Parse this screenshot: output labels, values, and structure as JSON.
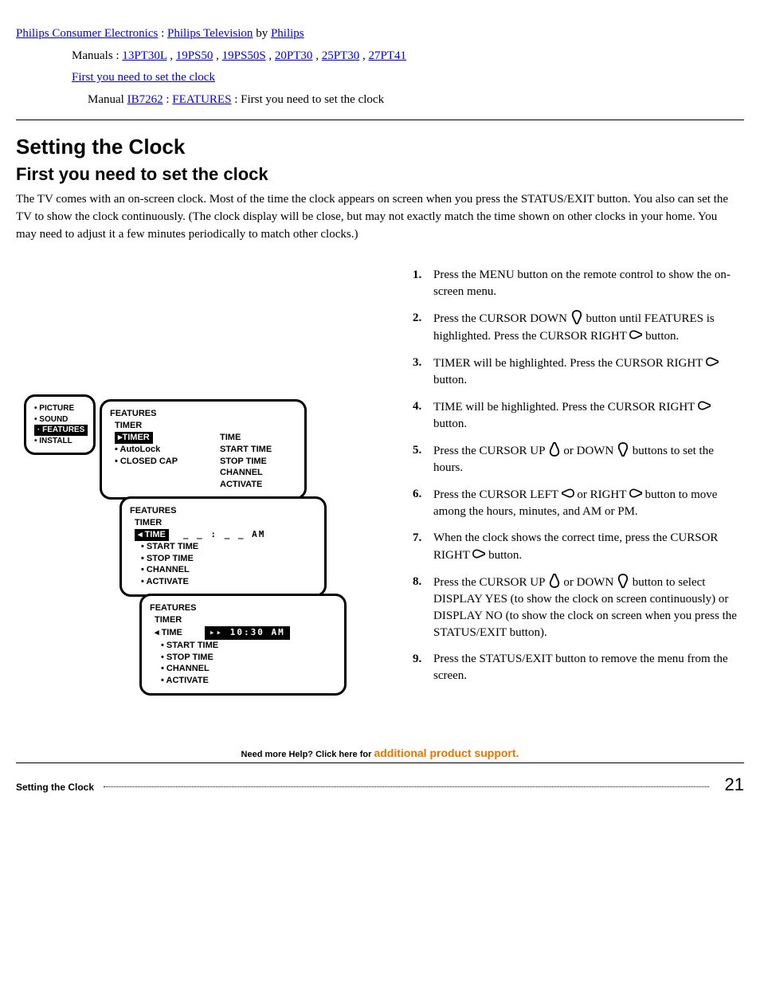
{
  "breadcrumbs": {
    "home": "Philips Consumer Electronics",
    "div": "Philips Television",
    "by": "by ",
    "div2": "Philips",
    "line2_lead": "Manuals : ",
    "m1": "13PT30L",
    "m2": "19PS50",
    "m3": "19PS50S",
    "m4": "20PT30",
    "m5": "25PT30",
    "m6": "27PT41",
    "line3": "First you need to set the clock",
    "line4_pre": "Manual ",
    "mnum": "IB7262",
    "features": "FEATURES",
    "tail": " : First you need to set the clock",
    "opdiv": "  :  "
  },
  "heading1": "Setting the Clock",
  "heading2": "First you need to set the clock",
  "intro": "The TV comes with an on-screen clock. Most of the time the clock appears on screen when you press the STATUS/EXIT button. You also can set the TV to show the clock continuously. (The clock display will be close, but may not exactly match the time shown on other clocks in your home. You may need to adjust it a few minutes periodically to match other clocks.)",
  "steps": {
    "s1": "Press the MENU button on the remote control to show the on-screen menu.",
    "s2a": "Press the CURSOR DOWN ",
    "s2b": " button until FEATURES is highlighted. Press the CURSOR RIGHT ",
    "s2c": " button.",
    "s3a": "TIMER will be highlighted. Press the CURSOR RIGHT ",
    "s3b": " button.",
    "s4a": "TIME will be highlighted. Press the CURSOR RIGHT ",
    "s4b": " button.",
    "s5a": "Press the CURSOR UP ",
    "s5b": " or DOWN ",
    "s5c": " buttons to set the hours.",
    "s6a": "Press the CURSOR LEFT ",
    "s6b": " or RIGHT ",
    "s6c": " button to move among the hours, minutes, and AM or PM.",
    "s7a": "When the clock shows the correct time, press the CURSOR RIGHT ",
    "s7b": " button.",
    "s8a": "Press the CURSOR UP ",
    "s8b": " or DOWN ",
    "s8c": " button to select DISPLAY YES (to show the clock on screen continuously) or DISPLAY NO (to show the clock on screen when you press the STATUS/EXIT button).",
    "s9": "Press the STATUS/EXIT button to remove the menu from the screen."
  },
  "osd": {
    "panel1": {
      "i1": "PICTURE",
      "i2": "SOUND",
      "i3": "FEATURES",
      "i4": "INSTALL"
    },
    "panel2": {
      "title": "FEATURES",
      "sub": "TIMER",
      "tl1": "TIMER",
      "tl2": "AutoLock",
      "tl3": "CLOSED CAP",
      "r1": "TIME",
      "r2": "START TIME",
      "r3": "STOP TIME",
      "r4": "CHANNEL",
      "r5": "ACTIVATE"
    },
    "panel3": {
      "title": "FEATURES",
      "sub": "TIMER",
      "v1": "TIME",
      "am": "_ _ : _ _   AM",
      "l1": "START TIME",
      "l2": "STOP TIME",
      "l3": "CHANNEL",
      "l4": "ACTIVATE"
    },
    "panel4": {
      "title": "FEATURES",
      "sub": "TIMER",
      "v1": "TIME",
      "t": "▸▸ 10:30 AM",
      "l1": "START TIME",
      "l2": "STOP TIME",
      "l3": "CHANNEL",
      "l4": "ACTIVATE"
    }
  },
  "footer": {
    "help": "Need more Help? Click here for ",
    "prod": "additional product support.",
    "title": "Setting the Clock",
    "pg": "21"
  }
}
